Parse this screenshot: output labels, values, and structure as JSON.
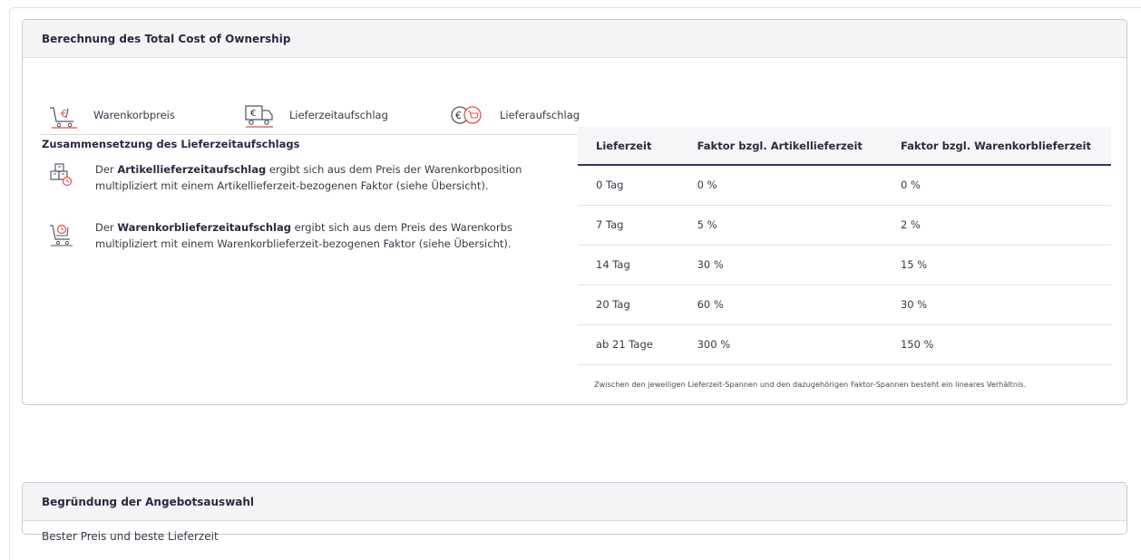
{
  "tco": {
    "title": "Berechnung des Total Cost of Ownership",
    "legend": [
      {
        "icon": "cart-euro-icon",
        "label": "Warenkorbpreis"
      },
      {
        "icon": "truck-euro-icon",
        "label": "Lieferzeitaufschlag"
      },
      {
        "icon": "euro-cart-circle-icon",
        "label": "Lieferaufschlag"
      }
    ],
    "subtitle": "Zusammensetzung des Lieferzeitaufschlags",
    "explanations": [
      {
        "icon": "boxes-clock-icon",
        "pre": "Der ",
        "bold": "Artikellieferzeitaufschlag",
        "post": " ergibt sich aus dem Preis der Warenkorbposition multipliziert mit einem Artikellieferzeit-bezogenen Faktor (siehe Übersicht)."
      },
      {
        "icon": "cart-clock-icon",
        "pre": "Der ",
        "bold": "Warenkorblieferzeitaufschlag",
        "post": " ergibt sich aus dem Preis des Warenkorbs multipliziert mit einem Warenkorblieferzeit-bezogenen Faktor (siehe Übersicht)."
      }
    ],
    "table": {
      "headers": [
        "Lieferzeit",
        "Faktor bzgl. Artikellieferzeit",
        "Faktor bzgl. Warenkorblieferzeit"
      ],
      "rows": [
        [
          "0 Tag",
          "0 %",
          "0 %"
        ],
        [
          "7 Tag",
          "5 %",
          "2 %"
        ],
        [
          "14 Tag",
          "30 %",
          "15 %"
        ],
        [
          "20 Tag",
          "60 %",
          "30 %"
        ],
        [
          "ab 21 Tage",
          "300 %",
          "150 %"
        ]
      ],
      "note": "Zwischen den jeweiligen Lieferzeit-Spannen und den dazugehörigen Faktor-Spannen besteht ein lineares Verhältnis."
    }
  },
  "reason": {
    "title": "Begründung der Angebotsauswahl",
    "text": "Bester Preis und beste Lieferzeit"
  },
  "colors": {
    "accent_red": "#e0524a",
    "icon_gray": "#5a5a68",
    "header_rule": "#34345a"
  }
}
